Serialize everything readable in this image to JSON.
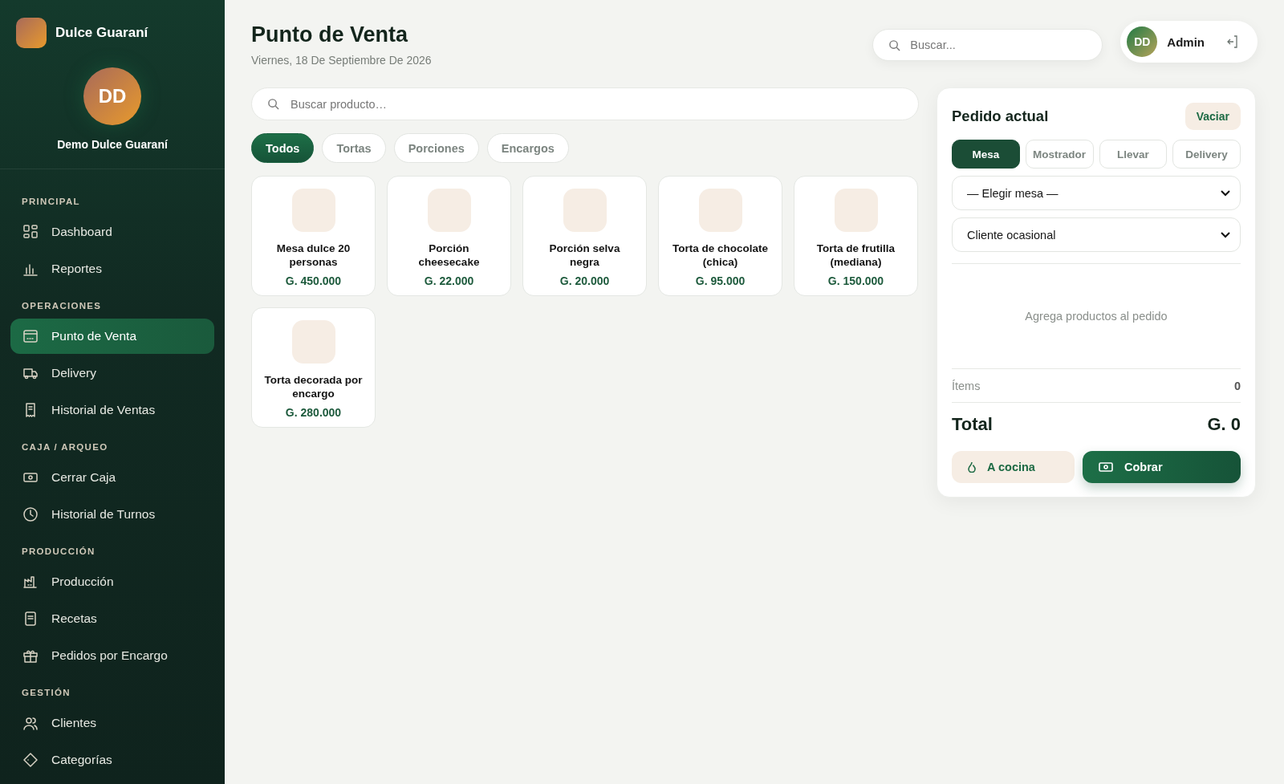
{
  "brand": {
    "name": "Dulce Guaraní"
  },
  "profile": {
    "initials": "DD",
    "name": "Demo Dulce Guaraní"
  },
  "sidebar": {
    "sections": [
      {
        "title": "PRINCIPAL",
        "items": [
          {
            "label": "Dashboard",
            "selected": false
          },
          {
            "label": "Reportes",
            "selected": false
          }
        ]
      },
      {
        "title": "OPERACIONES",
        "items": [
          {
            "label": "Punto de Venta",
            "selected": true
          },
          {
            "label": "Delivery",
            "selected": false
          },
          {
            "label": "Historial de Ventas",
            "selected": false
          }
        ]
      },
      {
        "title": "CAJA / ARQUEO",
        "items": [
          {
            "label": "Cerrar Caja",
            "selected": false
          },
          {
            "label": "Historial de Turnos",
            "selected": false
          }
        ]
      },
      {
        "title": "PRODUCCIÓN",
        "items": [
          {
            "label": "Producción",
            "selected": false
          },
          {
            "label": "Recetas",
            "selected": false
          },
          {
            "label": "Pedidos por Encargo",
            "selected": false
          }
        ]
      },
      {
        "title": "GESTIÓN",
        "items": [
          {
            "label": "Clientes",
            "selected": false
          },
          {
            "label": "Categorías",
            "selected": false
          }
        ]
      }
    ]
  },
  "header": {
    "title": "Punto de Venta",
    "date": "Viernes, 18 De Septiembre De 2026"
  },
  "top_search": {
    "placeholder": "Buscar..."
  },
  "user": {
    "initials": "DD",
    "name": "Admin"
  },
  "product_search": {
    "placeholder": "Buscar producto…"
  },
  "filters": [
    {
      "label": "Todos",
      "selected": true
    },
    {
      "label": "Tortas",
      "selected": false
    },
    {
      "label": "Porciones",
      "selected": false
    },
    {
      "label": "Encargos",
      "selected": false
    }
  ],
  "products": [
    {
      "name": "Mesa dulce 20 personas",
      "price": "G. 450.000"
    },
    {
      "name": "Porción cheesecake",
      "price": "G. 22.000"
    },
    {
      "name": "Porción selva negra",
      "price": "G. 20.000"
    },
    {
      "name": "Torta de chocolate (chica)",
      "price": "G. 95.000"
    },
    {
      "name": "Torta de frutilla (mediana)",
      "price": "G. 150.000"
    },
    {
      "name": "Torta decorada por encargo",
      "price": "G. 280.000"
    }
  ],
  "order": {
    "title": "Pedido actual",
    "clear_button": "Vaciar",
    "types": [
      {
        "label": "Mesa",
        "selected": true
      },
      {
        "label": "Mostrador",
        "selected": false
      },
      {
        "label": "Llevar",
        "selected": false
      },
      {
        "label": "Delivery",
        "selected": false
      }
    ],
    "table_select": {
      "value": "— Elegir mesa —"
    },
    "client_select": {
      "value": "Cliente ocasional"
    },
    "empty_message": "Agrega productos al pedido",
    "items_label": "Ítems",
    "items_value": "0",
    "total_label": "Total",
    "total_value": "G. 0",
    "kitchen_button": "A cocina",
    "charge_button": "Cobrar"
  }
}
